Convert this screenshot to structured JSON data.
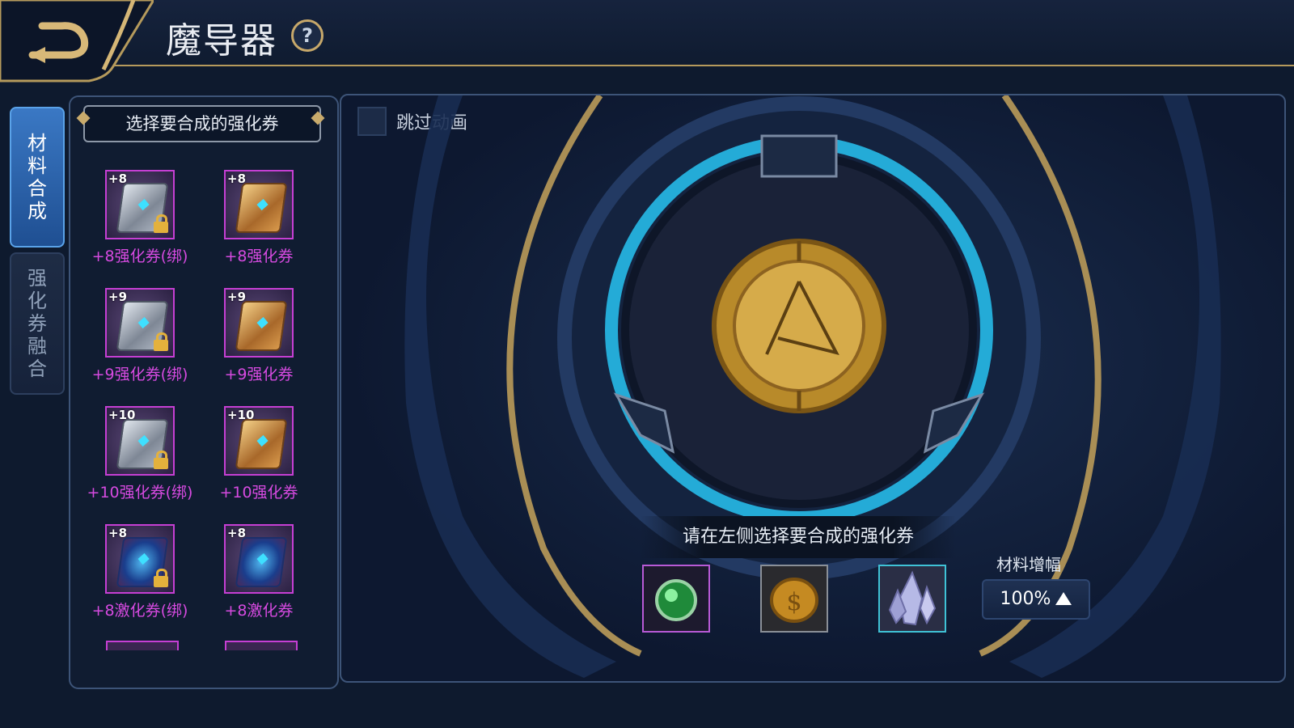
{
  "header": {
    "title": "魔导器",
    "help_label": "?"
  },
  "tabs": [
    {
      "label": [
        "材",
        "料",
        "合",
        "成"
      ]
    },
    {
      "label": [
        "强",
        "化",
        "券",
        "融",
        "合"
      ]
    }
  ],
  "left_panel": {
    "header": "选择要合成的强化券",
    "items": [
      {
        "level": "+8",
        "name": "+8强化券(绑)",
        "style": "silver",
        "locked": true
      },
      {
        "level": "+8",
        "name": "+8强化券",
        "style": "gold",
        "locked": false
      },
      {
        "level": "+9",
        "name": "+9强化券(绑)",
        "style": "silver",
        "locked": true
      },
      {
        "level": "+9",
        "name": "+9强化券",
        "style": "gold",
        "locked": false
      },
      {
        "level": "+10",
        "name": "+10强化券(绑)",
        "style": "silver",
        "locked": true
      },
      {
        "level": "+10",
        "name": "+10强化券",
        "style": "gold",
        "locked": false
      },
      {
        "level": "+8",
        "name": "+8激化券(绑)",
        "style": "blue",
        "locked": true
      },
      {
        "level": "+8",
        "name": "+8激化券",
        "style": "blue",
        "locked": false
      }
    ]
  },
  "main": {
    "skip_animation_label": "跳过动画",
    "instruction": "请在左侧选择要合成的强化券",
    "materials": [
      {
        "icon": "green-orb-icon",
        "border": "#b85ad6"
      },
      {
        "icon": "gold-coin-icon",
        "border": "#8a8f97"
      },
      {
        "icon": "crystal-icon",
        "border": "#3fc2d6"
      }
    ],
    "amplify_label": "材料增幅",
    "amplify_value": "100%"
  },
  "colors": {
    "accent_gold": "#c9ab6c",
    "item_purple": "#d64ae0",
    "tab_active": "#2f6bb8",
    "glow_cyan": "#27c3f2"
  }
}
